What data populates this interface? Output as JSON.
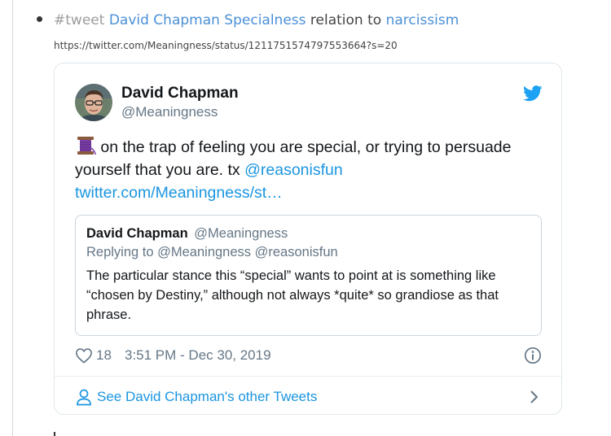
{
  "heading": {
    "tag": "#tweet",
    "topic": "David Chapman Specialness",
    "connector": "relation to",
    "target": "narcissism"
  },
  "source_url": "https://twitter.com/Meaningness/status/1211751574797553664?s=20",
  "tweet": {
    "author_name": "David Chapman",
    "author_handle": "@Meaningness",
    "text_before": " on the trap of feeling you are special, or trying to persuade yourself that you are. tx ",
    "mention": "@reasonisfun",
    "link": "twitter.com/Meaningness/st…",
    "quoted": {
      "author_name": "David Chapman",
      "author_handle": "@Meaningness",
      "replying_to": "Replying to @Meaningness @reasonisfun",
      "text": "The particular stance this “special” wants to point at is something like “chosen by Destiny,” although not always *quite* so grandiose as that phrase."
    },
    "likes": "18",
    "timestamp": "3:51 PM - Dec 30, 2019",
    "footer_label": "See David Chapman's other Tweets"
  },
  "colors": {
    "link_blue": "#1b95e0",
    "heading_link": "#4a90d9",
    "muted": "#657786",
    "border": "#e1e8ed"
  },
  "icons": [
    "spool-of-thread-icon",
    "twitter-bird-icon",
    "heart-icon",
    "info-icon",
    "person-icon",
    "chevron-right-icon"
  ]
}
